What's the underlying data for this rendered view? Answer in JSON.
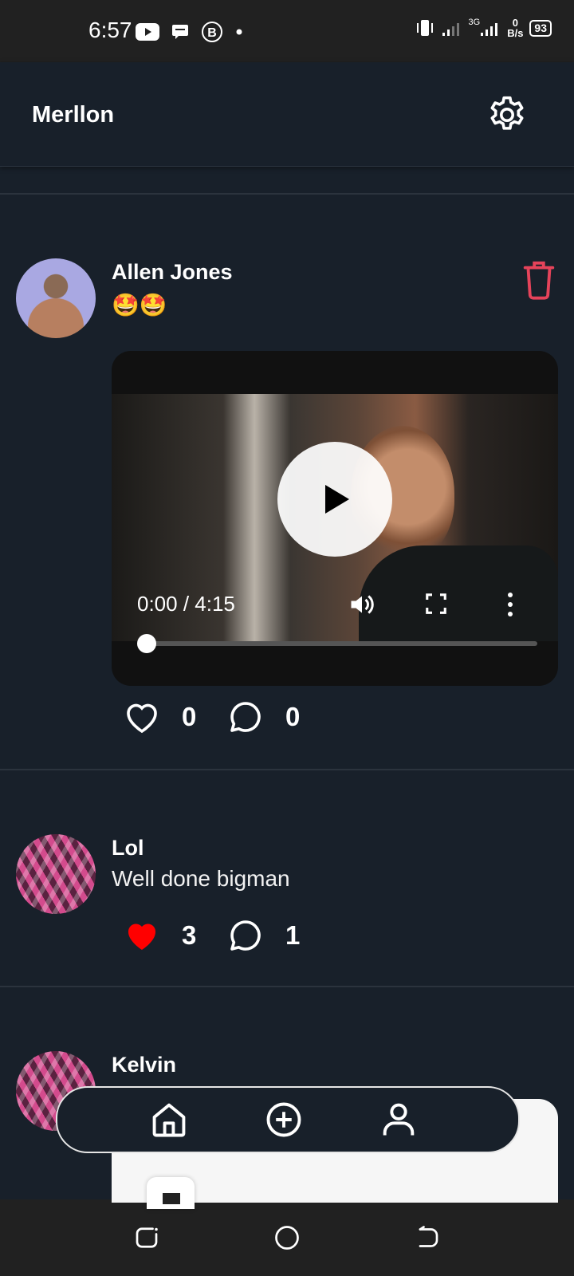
{
  "status_bar": {
    "time": "6:57",
    "net_speed_value": "0",
    "net_speed_unit": "B/s",
    "network_type": "3G",
    "battery": "93"
  },
  "app_bar": {
    "title": "Merllon"
  },
  "posts": [
    {
      "author": "Allen Jones",
      "text": "🤩🤩",
      "video": {
        "time": "0:00 / 4:15",
        "progress": 0
      },
      "likes": "0",
      "comments": "0",
      "liked": false
    },
    {
      "author": "Lol",
      "text": "Well done bigman",
      "likes": "3",
      "comments": "1",
      "liked": true
    },
    {
      "author": "Kelvin"
    }
  ],
  "colors": {
    "background": "#18202a",
    "like_active": "#ff0000",
    "delete": "#e5435a",
    "status_bar": "#212121"
  },
  "icons": {
    "settings": "gear-icon",
    "delete": "trash-icon",
    "like": "heart-icon",
    "comment": "speech-bubble-icon",
    "nav_home": "home-icon",
    "nav_add": "plus-circle-icon",
    "nav_profile": "person-icon"
  }
}
